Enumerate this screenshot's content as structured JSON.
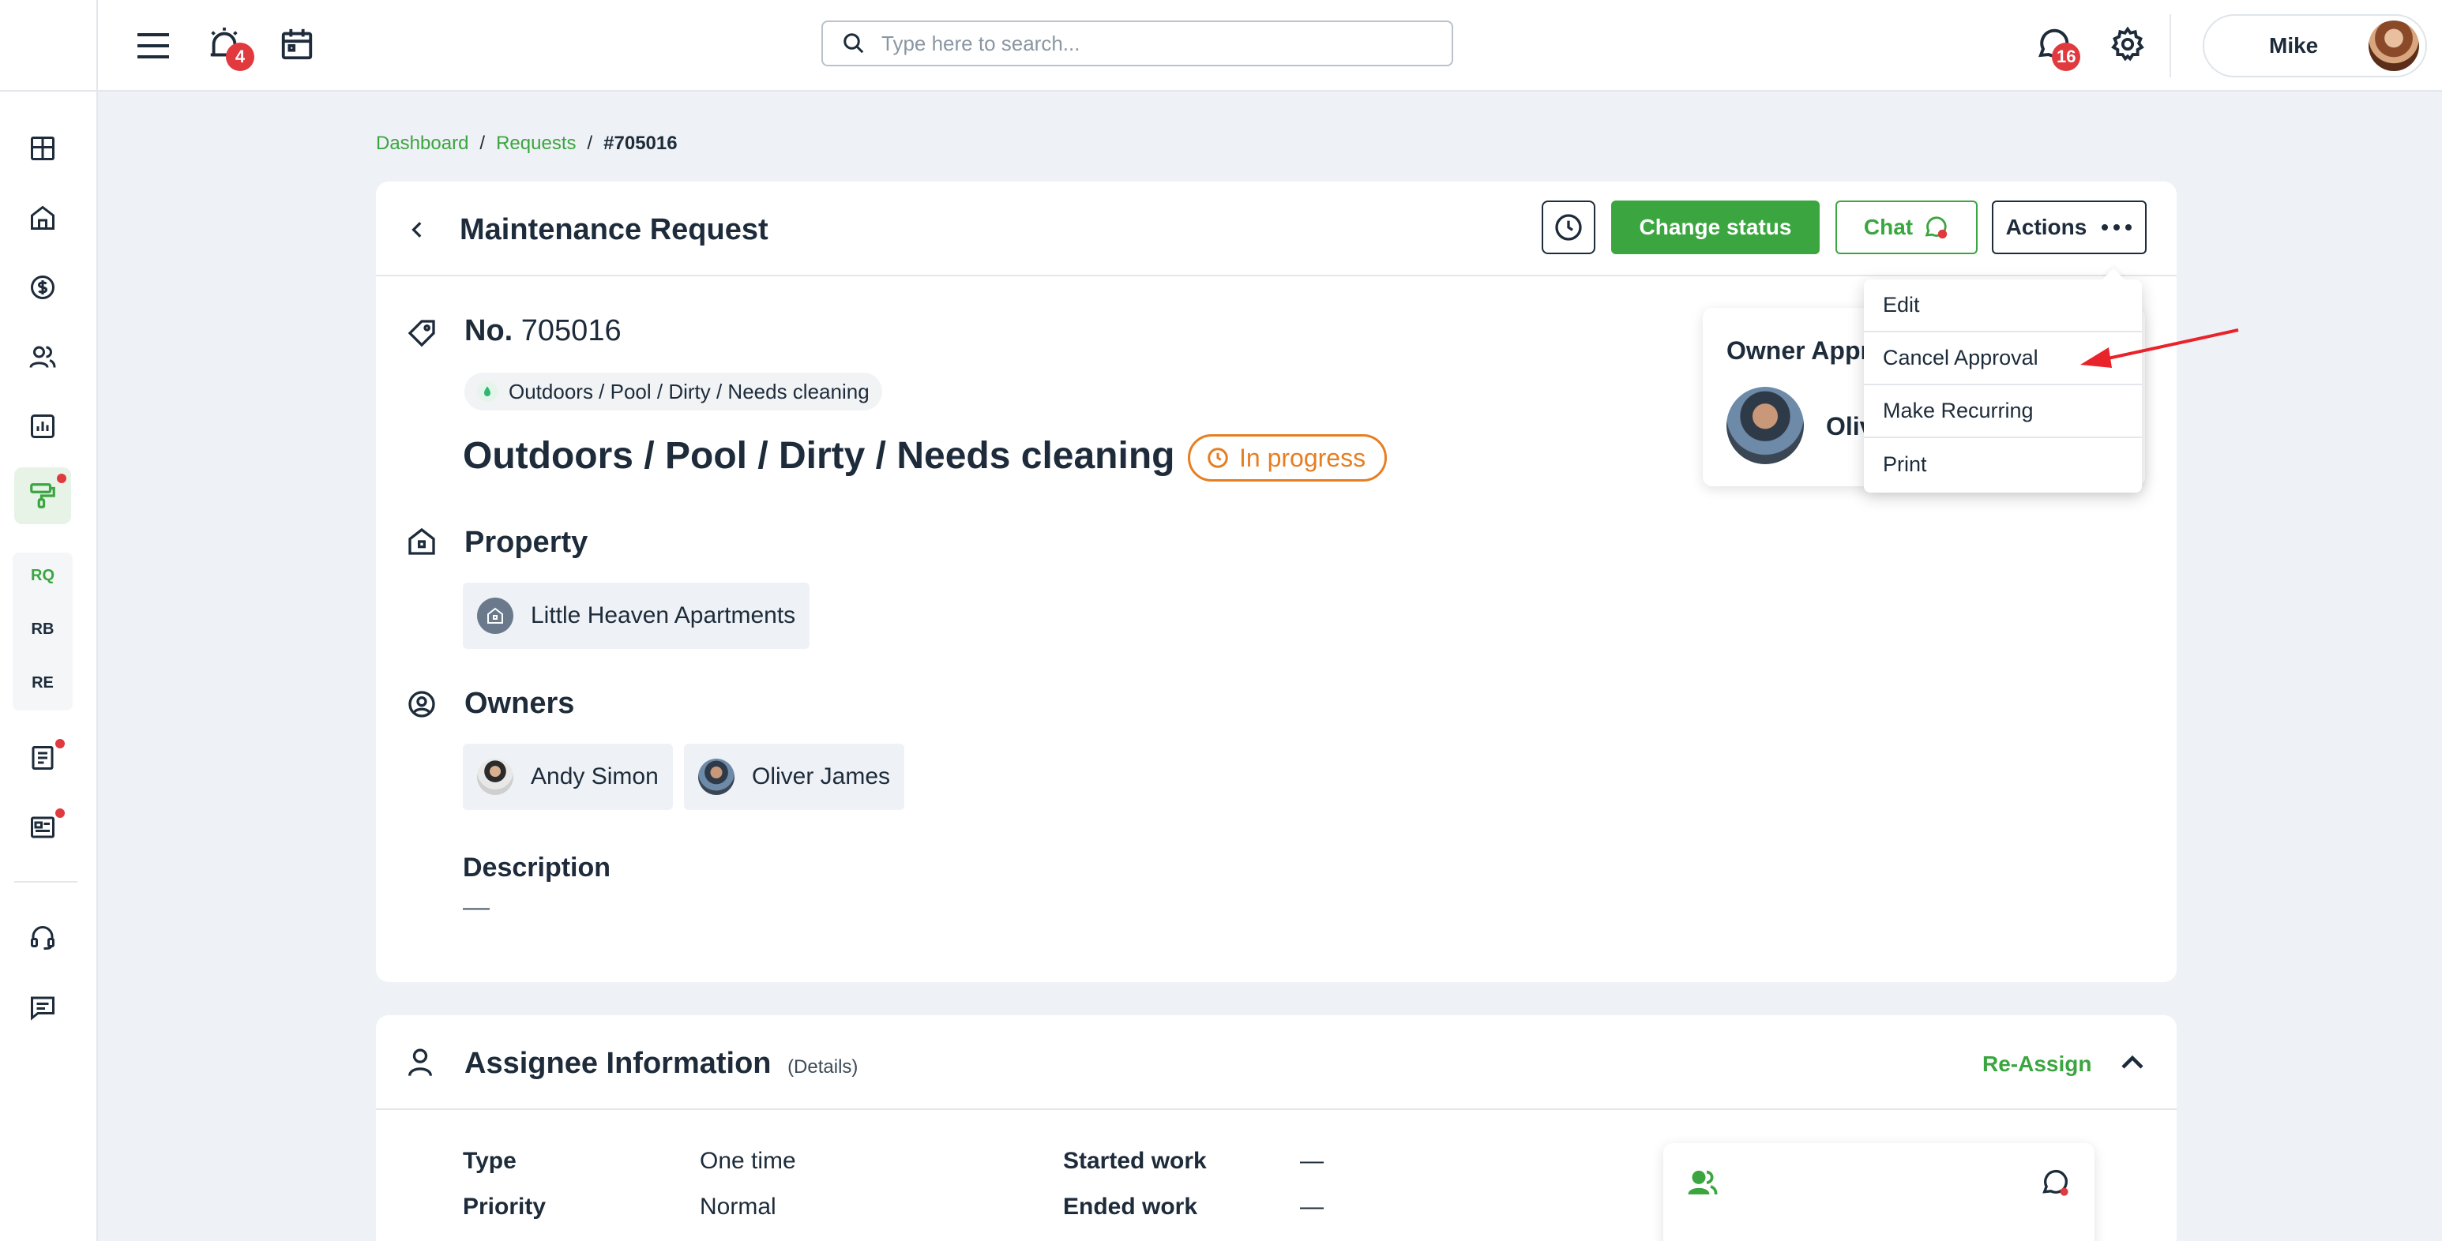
{
  "topbar": {
    "notification_badge": "4",
    "search_placeholder": "Type here to search...",
    "chat_badge": "16",
    "user_name": "Mike"
  },
  "sidebar": {
    "subitems": [
      "RQ",
      "RB",
      "RE"
    ]
  },
  "breadcrumb": {
    "items": [
      "Dashboard",
      "Requests"
    ],
    "separator": "/",
    "current": "#705016"
  },
  "request": {
    "page_title": "Maintenance Request",
    "buttons": {
      "change_status": "Change status",
      "chat": "Chat",
      "actions": "Actions"
    },
    "number_label": "No.",
    "number": "705016",
    "category_chip": "Outdoors / Pool / Dirty / Needs cleaning",
    "title": "Outdoors / Pool / Dirty / Needs cleaning",
    "status": "In progress",
    "property_label": "Property",
    "property_name": "Little Heaven Apartments",
    "owners_label": "Owners",
    "owners": [
      "Andy Simon",
      "Oliver James"
    ],
    "description_label": "Description",
    "description": "—",
    "approval_title": "Owner Appr",
    "approval_name": "Oliv"
  },
  "actions_menu": {
    "items": [
      "Edit",
      "Cancel Approval",
      "Make Recurring",
      "Print"
    ]
  },
  "assignee": {
    "title": "Assignee Information",
    "details_link": "(Details)",
    "reassign": "Re-Assign",
    "fields": [
      {
        "label": "Type",
        "value": "One time"
      },
      {
        "label": "Priority",
        "value": "Normal"
      },
      {
        "label": "Started work",
        "value": "—"
      },
      {
        "label": "Ended work",
        "value": "—"
      }
    ]
  },
  "colors": {
    "accent_green": "#3ba53f",
    "status_orange": "#e67e22",
    "badge_red": "#e0393e",
    "annotation_arrow": "#e8232a"
  }
}
